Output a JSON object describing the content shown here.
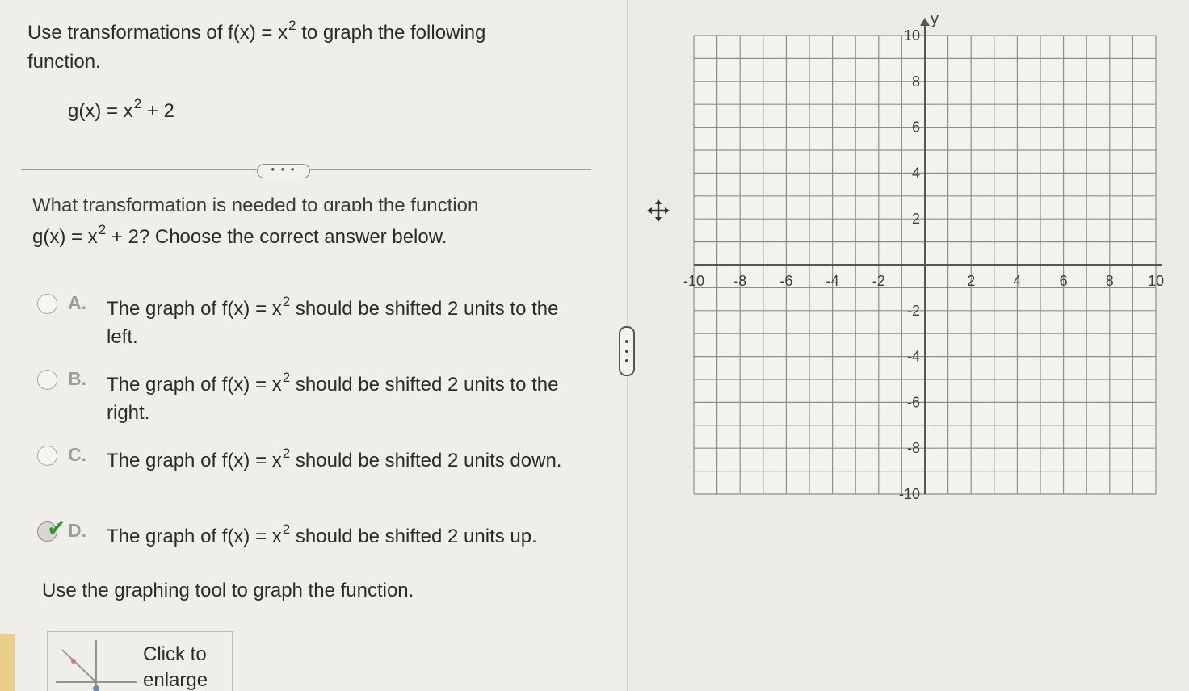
{
  "question": {
    "prefix": "Use transformations of f(x) = x",
    "exp": "2",
    "suffix": " to graph the following function."
  },
  "function": {
    "prefix": "g(x) = x",
    "exp": "2",
    "suffix": " + 2"
  },
  "more_button": "• • •",
  "cut_question": "What transformation is needed to graph the function",
  "prompt": {
    "prefix": "g(x) = x",
    "exp": "2",
    "suffix": " + 2? Choose the correct answer below."
  },
  "options": [
    {
      "letter": "A.",
      "prefix": "The graph of f(x) = x",
      "exp": "2",
      "suffix": " should be shifted 2 units to the left.",
      "selected": false
    },
    {
      "letter": "B.",
      "prefix": "The graph of f(x) = x",
      "exp": "2",
      "suffix": " should be shifted 2 units to the right.",
      "selected": false
    },
    {
      "letter": "C.",
      "prefix": "The graph of f(x) = x",
      "exp": "2",
      "suffix": " should be shifted 2 units down.",
      "selected": false
    },
    {
      "letter": "D.",
      "prefix": "The graph of f(x) = x",
      "exp": "2",
      "suffix": " should be shifted 2 units up.",
      "selected": true
    }
  ],
  "checkmark": "✔",
  "instruction": "Use the graphing tool to graph the function.",
  "enlarge_button": {
    "line1": "Click to",
    "line2": "enlarge"
  },
  "graph": {
    "y_axis_label": "y",
    "x_range": [
      -10,
      10
    ],
    "y_range": [
      -10,
      10
    ],
    "grid_step": 1,
    "x_tick_labels": [
      "-10",
      "-8",
      "-6",
      "-4",
      "-2",
      "2",
      "4",
      "6",
      "8",
      "10"
    ],
    "y_tick_labels": [
      "10",
      "8",
      "6",
      "4",
      "2",
      "-2",
      "-4",
      "-6",
      "-8",
      "-10"
    ]
  },
  "colors": {
    "accent_check": "#2f9a2f",
    "grid_line": "#8f8e8a",
    "axis": "#555555"
  }
}
